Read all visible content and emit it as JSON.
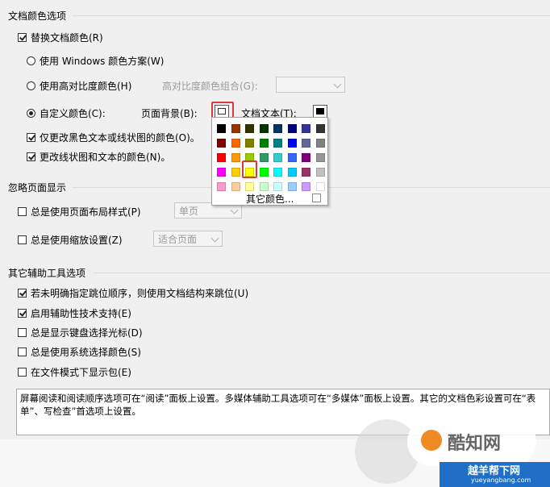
{
  "section_doc_colors": {
    "title": "文档颜色选项",
    "replace_doc_colors": "替换文档颜色(R)",
    "use_windows_scheme": "使用 Windows 颜色方案(W)",
    "use_high_contrast": "使用高对比度颜色(H)",
    "high_contrast_combo_label": "高对比度颜色组合(G):",
    "custom_color": "自定义颜色(C):",
    "page_background": "页面背景(B):",
    "document_text": "文档文本(T):",
    "only_black_text": "仅更改黑色文本或线状图的颜色(O)。",
    "change_line_art": "更改线状图和文本的颜色(N)。",
    "page_background_color": "#ffffff",
    "document_text_color": "#000000"
  },
  "palette": {
    "more_colors": "其它颜色...",
    "rows": [
      [
        "#000000",
        "#993300",
        "#333300",
        "#003300",
        "#003366",
        "#000080",
        "#333399",
        "#333333"
      ],
      [
        "#800000",
        "#ff6600",
        "#808000",
        "#008000",
        "#008080",
        "#0000ff",
        "#666699",
        "#808080"
      ],
      [
        "#ff0000",
        "#ff9900",
        "#99cc00",
        "#339966",
        "#33cccc",
        "#3366ff",
        "#800080",
        "#969696"
      ],
      [
        "#ff00ff",
        "#ffcc00",
        "#ffff00",
        "#00ff00",
        "#00ffff",
        "#00ccff",
        "#993366",
        "#c0c0c0"
      ],
      [
        "#ff99cc",
        "#ffcc99",
        "#ffff99",
        "#ccffcc",
        "#ccffff",
        "#99ccff",
        "#cc99ff",
        "#ffffff"
      ]
    ]
  },
  "section_ignore_layout": {
    "title": "忽略页面显示",
    "always_page_layout": "总是使用页面布局样式(P)",
    "page_layout_value": "单页",
    "always_zoom": "总是使用缩放设置(Z)",
    "zoom_value": "适合页面"
  },
  "section_other": {
    "title": "其它辅助工具选项",
    "use_structure_order": "若未明确指定跳位顺序，则使用文档结构来跳位(U)",
    "enable_assistive": "启用辅助性技术支持(E)",
    "show_keyboard_cursor": "总是显示键盘选择光标(D)",
    "use_system_selection": "总是使用系统选择颜色(S)",
    "show_portfolio": "在文件模式下显示包(E)",
    "description": "屏幕阅读和阅读顺序选项可在“阅读”面板上设置。多媒体辅助工具选项可在“多媒体”面板上设置。其它的文档色彩设置可在“表单”、写检查”首选项上设置。"
  },
  "watermark": {
    "brand_text": "酷知网",
    "site_text": "yueyangbang.com",
    "site_title": "越羊帮下网"
  }
}
